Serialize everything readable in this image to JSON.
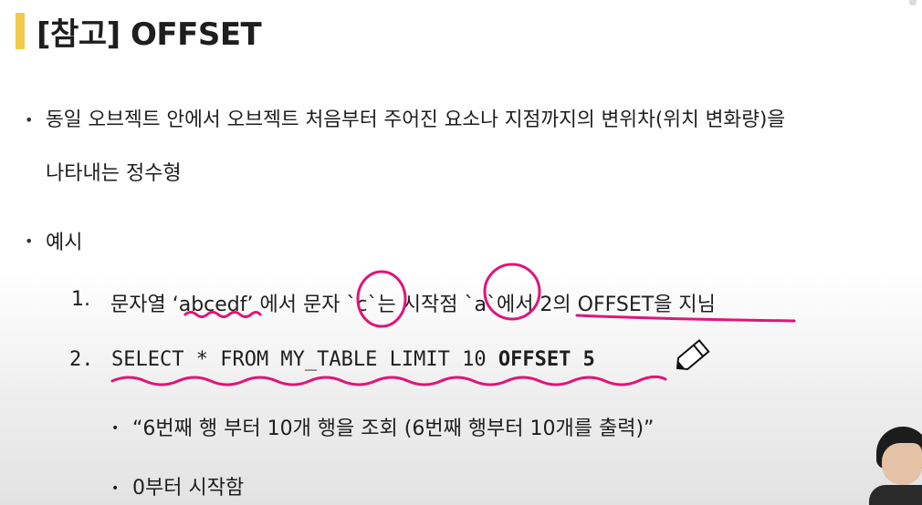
{
  "slide": {
    "title": "[참고] OFFSET",
    "bullet_symbol": "•",
    "bullet1_line1": "동일 오브젝트 안에서 오브젝트 처음부터 주어진 요소나 지점까지의 변위차(위치 변화량)을",
    "bullet1_line2": "나타내는 정수형",
    "bullet2": "예시",
    "item1_num": "1.",
    "item1_text": "문자열 ‘abcedf’ 에서 문자 `c`는 시작점 `a`에서 2의 OFFSET을 지님",
    "item2_num": "2.",
    "item2_code_normal": "SELECT * FROM MY_TABLE LIMIT 10 ",
    "item2_code_bold": "OFFSET 5",
    "sub1": "“6번째 행 부터 10개 행을 조회 (6번째 행부터 10개를 출력)”",
    "sub2": "0부터 시작함"
  },
  "colors": {
    "accent_bar": "#f2c94c",
    "annotation_pen": "#e0157a"
  },
  "icons": {
    "cursor": "pencil-cursor-icon"
  }
}
